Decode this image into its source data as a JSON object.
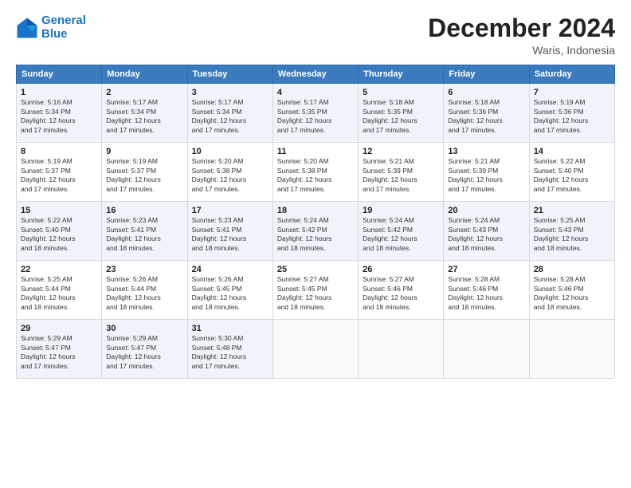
{
  "logo": {
    "line1": "General",
    "line2": "Blue"
  },
  "title": "December 2024",
  "location": "Waris, Indonesia",
  "days_of_week": [
    "Sunday",
    "Monday",
    "Tuesday",
    "Wednesday",
    "Thursday",
    "Friday",
    "Saturday"
  ],
  "weeks": [
    [
      {
        "day": "1",
        "info": "Sunrise: 5:16 AM\nSunset: 5:34 PM\nDaylight: 12 hours\nand 17 minutes."
      },
      {
        "day": "2",
        "info": "Sunrise: 5:17 AM\nSunset: 5:34 PM\nDaylight: 12 hours\nand 17 minutes."
      },
      {
        "day": "3",
        "info": "Sunrise: 5:17 AM\nSunset: 5:34 PM\nDaylight: 12 hours\nand 17 minutes."
      },
      {
        "day": "4",
        "info": "Sunrise: 5:17 AM\nSunset: 5:35 PM\nDaylight: 12 hours\nand 17 minutes."
      },
      {
        "day": "5",
        "info": "Sunrise: 5:18 AM\nSunset: 5:35 PM\nDaylight: 12 hours\nand 17 minutes."
      },
      {
        "day": "6",
        "info": "Sunrise: 5:18 AM\nSunset: 5:36 PM\nDaylight: 12 hours\nand 17 minutes."
      },
      {
        "day": "7",
        "info": "Sunrise: 5:19 AM\nSunset: 5:36 PM\nDaylight: 12 hours\nand 17 minutes."
      }
    ],
    [
      {
        "day": "8",
        "info": "Sunrise: 5:19 AM\nSunset: 5:37 PM\nDaylight: 12 hours\nand 17 minutes."
      },
      {
        "day": "9",
        "info": "Sunrise: 5:19 AM\nSunset: 5:37 PM\nDaylight: 12 hours\nand 17 minutes."
      },
      {
        "day": "10",
        "info": "Sunrise: 5:20 AM\nSunset: 5:38 PM\nDaylight: 12 hours\nand 17 minutes."
      },
      {
        "day": "11",
        "info": "Sunrise: 5:20 AM\nSunset: 5:38 PM\nDaylight: 12 hours\nand 17 minutes."
      },
      {
        "day": "12",
        "info": "Sunrise: 5:21 AM\nSunset: 5:39 PM\nDaylight: 12 hours\nand 17 minutes."
      },
      {
        "day": "13",
        "info": "Sunrise: 5:21 AM\nSunset: 5:39 PM\nDaylight: 12 hours\nand 17 minutes."
      },
      {
        "day": "14",
        "info": "Sunrise: 5:22 AM\nSunset: 5:40 PM\nDaylight: 12 hours\nand 17 minutes."
      }
    ],
    [
      {
        "day": "15",
        "info": "Sunrise: 5:22 AM\nSunset: 5:40 PM\nDaylight: 12 hours\nand 18 minutes."
      },
      {
        "day": "16",
        "info": "Sunrise: 5:23 AM\nSunset: 5:41 PM\nDaylight: 12 hours\nand 18 minutes."
      },
      {
        "day": "17",
        "info": "Sunrise: 5:23 AM\nSunset: 5:41 PM\nDaylight: 12 hours\nand 18 minutes."
      },
      {
        "day": "18",
        "info": "Sunrise: 5:24 AM\nSunset: 5:42 PM\nDaylight: 12 hours\nand 18 minutes."
      },
      {
        "day": "19",
        "info": "Sunrise: 5:24 AM\nSunset: 5:42 PM\nDaylight: 12 hours\nand 18 minutes."
      },
      {
        "day": "20",
        "info": "Sunrise: 5:24 AM\nSunset: 5:43 PM\nDaylight: 12 hours\nand 18 minutes."
      },
      {
        "day": "21",
        "info": "Sunrise: 5:25 AM\nSunset: 5:43 PM\nDaylight: 12 hours\nand 18 minutes."
      }
    ],
    [
      {
        "day": "22",
        "info": "Sunrise: 5:25 AM\nSunset: 5:44 PM\nDaylight: 12 hours\nand 18 minutes."
      },
      {
        "day": "23",
        "info": "Sunrise: 5:26 AM\nSunset: 5:44 PM\nDaylight: 12 hours\nand 18 minutes."
      },
      {
        "day": "24",
        "info": "Sunrise: 5:26 AM\nSunset: 5:45 PM\nDaylight: 12 hours\nand 18 minutes."
      },
      {
        "day": "25",
        "info": "Sunrise: 5:27 AM\nSunset: 5:45 PM\nDaylight: 12 hours\nand 18 minutes."
      },
      {
        "day": "26",
        "info": "Sunrise: 5:27 AM\nSunset: 5:46 PM\nDaylight: 12 hours\nand 18 minutes."
      },
      {
        "day": "27",
        "info": "Sunrise: 5:28 AM\nSunset: 5:46 PM\nDaylight: 12 hours\nand 18 minutes."
      },
      {
        "day": "28",
        "info": "Sunrise: 5:28 AM\nSunset: 5:46 PM\nDaylight: 12 hours\nand 18 minutes."
      }
    ],
    [
      {
        "day": "29",
        "info": "Sunrise: 5:29 AM\nSunset: 5:47 PM\nDaylight: 12 hours\nand 17 minutes."
      },
      {
        "day": "30",
        "info": "Sunrise: 5:29 AM\nSunset: 5:47 PM\nDaylight: 12 hours\nand 17 minutes."
      },
      {
        "day": "31",
        "info": "Sunrise: 5:30 AM\nSunset: 5:48 PM\nDaylight: 12 hours\nand 17 minutes."
      },
      {
        "day": "",
        "info": ""
      },
      {
        "day": "",
        "info": ""
      },
      {
        "day": "",
        "info": ""
      },
      {
        "day": "",
        "info": ""
      }
    ]
  ]
}
